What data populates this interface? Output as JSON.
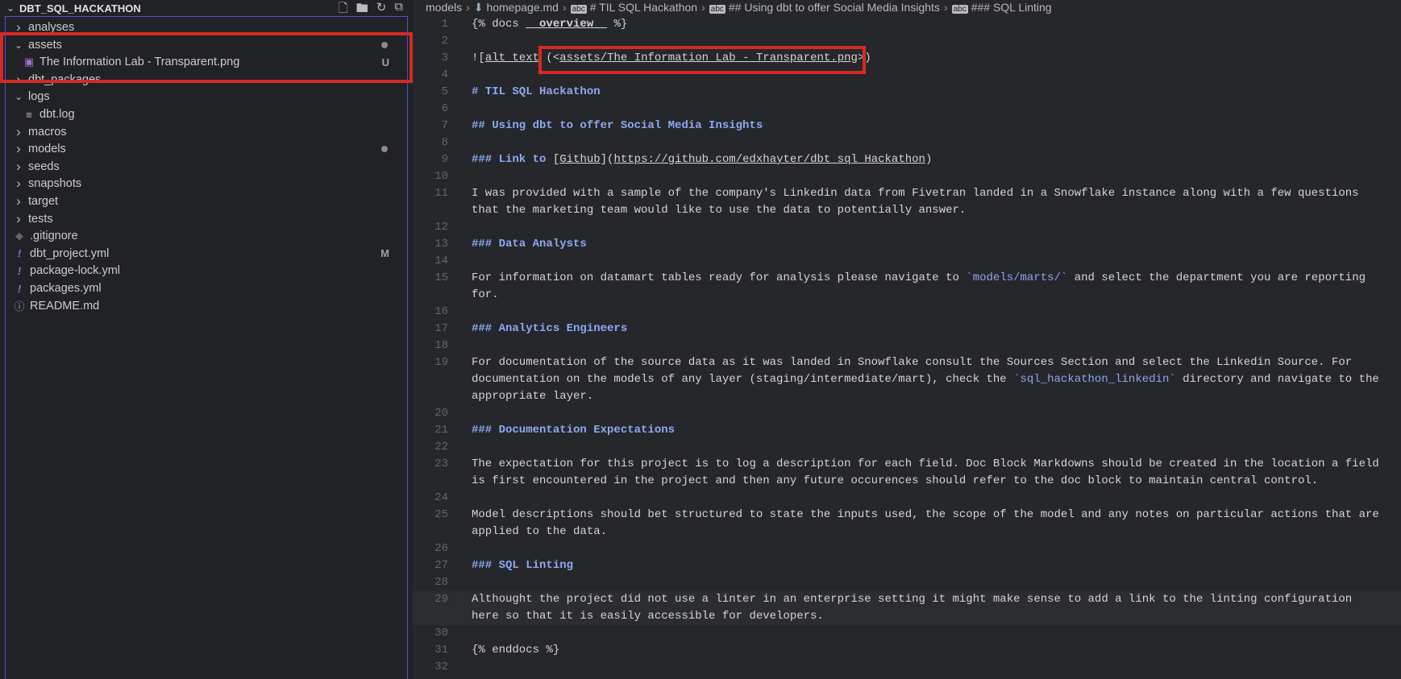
{
  "sidebar": {
    "title": "DBT_SQL_HACKATHON",
    "actions": [
      "new-file-icon",
      "new-folder-icon",
      "refresh-icon",
      "collapse-all-icon"
    ],
    "items": [
      {
        "label": "analyses",
        "type": "folder",
        "open": false,
        "depth": 0
      },
      {
        "label": "assets",
        "type": "folder",
        "open": true,
        "depth": 0,
        "dot": true
      },
      {
        "label": "The Information Lab - Transparent.png",
        "type": "image",
        "depth": 1,
        "badge": "U"
      },
      {
        "label": "dbt_packages",
        "type": "folder",
        "open": false,
        "depth": 0
      },
      {
        "label": "logs",
        "type": "folder",
        "open": true,
        "depth": 0
      },
      {
        "label": "dbt.log",
        "type": "log",
        "depth": 1
      },
      {
        "label": "macros",
        "type": "folder",
        "open": false,
        "depth": 0
      },
      {
        "label": "models",
        "type": "folder",
        "open": false,
        "depth": 0,
        "dot": true
      },
      {
        "label": "seeds",
        "type": "folder",
        "open": false,
        "depth": 0
      },
      {
        "label": "snapshots",
        "type": "folder",
        "open": false,
        "depth": 0
      },
      {
        "label": "target",
        "type": "folder",
        "open": false,
        "depth": 0
      },
      {
        "label": "tests",
        "type": "folder",
        "open": false,
        "depth": 0
      },
      {
        "label": ".gitignore",
        "type": "git",
        "depth": 0
      },
      {
        "label": "dbt_project.yml",
        "type": "yaml",
        "depth": 0,
        "badge": "M"
      },
      {
        "label": "package-lock.yml",
        "type": "yaml",
        "depth": 0
      },
      {
        "label": "packages.yml",
        "type": "yaml",
        "depth": 0
      },
      {
        "label": "README.md",
        "type": "info",
        "depth": 0
      }
    ]
  },
  "breadcrumb": [
    "models",
    "homepage.md",
    "# TIL SQL Hackathon",
    "## Using dbt to offer Social Media Insights",
    "### SQL Linting"
  ],
  "colors": {
    "accent": "#4a55c4",
    "highlight": "#d42a26",
    "heading": "#8fa8f2"
  },
  "lines": [
    {
      "n": "1",
      "rows": [
        [
          [
            "{% docs ",
            ""
          ],
          [
            "__overview__",
            "c-b c-u"
          ],
          [
            " %}",
            ""
          ]
        ]
      ]
    },
    {
      "n": "2",
      "rows": [
        []
      ]
    },
    {
      "n": "3",
      "rows": [
        [
          [
            "![",
            ""
          ],
          [
            "alt text",
            "c-u"
          ],
          [
            " (<",
            ""
          ],
          [
            "assets/The Information Lab - Transparent.png",
            "c-u"
          ],
          [
            ">)",
            ""
          ]
        ]
      ]
    },
    {
      "n": "4",
      "rows": [
        []
      ]
    },
    {
      "n": "5",
      "rows": [
        [
          [
            "# TIL SQL Hackathon",
            "c-h"
          ]
        ]
      ]
    },
    {
      "n": "6",
      "rows": [
        []
      ]
    },
    {
      "n": "7",
      "rows": [
        [
          [
            "## Using dbt to offer Social Media Insights",
            "c-h"
          ]
        ]
      ]
    },
    {
      "n": "8",
      "rows": [
        []
      ]
    },
    {
      "n": "9",
      "rows": [
        [
          [
            "### Link to ",
            "c-h"
          ],
          [
            "[",
            ""
          ],
          [
            "Github",
            "c-u"
          ],
          [
            "](",
            ""
          ],
          [
            "https://github.com/edxhayter/dbt_sql_Hackathon",
            "c-u"
          ],
          [
            ")",
            ""
          ]
        ]
      ]
    },
    {
      "n": "10",
      "rows": [
        []
      ]
    },
    {
      "n": "11",
      "rows": [
        [
          [
            "I was provided with a sample of the company's Linkedin data from Fivetran landed in a Snowflake instance along with a few questions",
            ""
          ]
        ],
        [
          [
            "that the marketing team would like to use the data to potentially answer.",
            ""
          ]
        ]
      ]
    },
    {
      "n": "12",
      "rows": [
        []
      ]
    },
    {
      "n": "13",
      "rows": [
        [
          [
            "### Data Analysts",
            "c-h"
          ]
        ]
      ]
    },
    {
      "n": "14",
      "rows": [
        []
      ]
    },
    {
      "n": "15",
      "rows": [
        [
          [
            "For information on datamart tables ready for analysis please navigate to ",
            ""
          ],
          [
            "`models/marts/`",
            "c-code"
          ],
          [
            " and select the department you are reporting",
            ""
          ]
        ],
        [
          [
            "for.",
            ""
          ]
        ]
      ]
    },
    {
      "n": "16",
      "rows": [
        []
      ]
    },
    {
      "n": "17",
      "rows": [
        [
          [
            "### Analytics Engineers",
            "c-h"
          ]
        ]
      ]
    },
    {
      "n": "18",
      "rows": [
        []
      ]
    },
    {
      "n": "19",
      "rows": [
        [
          [
            "For documentation of the source data as it was landed in Snowflake consult the Sources Section and select the Linkedin Source. For",
            ""
          ]
        ],
        [
          [
            "documentation on the models of any layer (staging/intermediate/mart), check the ",
            ""
          ],
          [
            "`sql_hackathon_linkedin`",
            "c-code"
          ],
          [
            " directory and navigate to the",
            ""
          ]
        ],
        [
          [
            "appropriate layer.",
            ""
          ]
        ]
      ]
    },
    {
      "n": "20",
      "rows": [
        []
      ]
    },
    {
      "n": "21",
      "rows": [
        [
          [
            "### Documentation Expectations",
            "c-h"
          ]
        ]
      ]
    },
    {
      "n": "22",
      "rows": [
        []
      ]
    },
    {
      "n": "23",
      "rows": [
        [
          [
            "The expectation for this project is to log a description for each field. Doc Block Markdowns should be created in the location a field",
            ""
          ]
        ],
        [
          [
            "is first encountered in the project and then any future occurences should refer to the doc block to maintain central control.",
            ""
          ]
        ]
      ]
    },
    {
      "n": "24",
      "rows": [
        []
      ]
    },
    {
      "n": "25",
      "rows": [
        [
          [
            "Model descriptions should bet structured to state the inputs used, the scope of the model and any notes on particular actions that are",
            ""
          ]
        ],
        [
          [
            "applied to the data.",
            ""
          ]
        ]
      ]
    },
    {
      "n": "26",
      "rows": [
        []
      ]
    },
    {
      "n": "27",
      "rows": [
        [
          [
            "### SQL Linting",
            "c-h"
          ]
        ]
      ]
    },
    {
      "n": "28",
      "rows": [
        []
      ]
    },
    {
      "n": "29",
      "current": true,
      "rows": [
        [
          [
            "Althought the project did not use a linter in an enterprise setting it might make sense to add a link to the linting configuration",
            ""
          ]
        ],
        [
          [
            "here so that it is easily accessible for developers.",
            ""
          ]
        ]
      ]
    },
    {
      "n": "30",
      "rows": [
        []
      ]
    },
    {
      "n": "31",
      "rows": [
        [
          [
            "{% enddocs %}",
            ""
          ]
        ]
      ]
    },
    {
      "n": "32",
      "rows": [
        []
      ]
    }
  ]
}
